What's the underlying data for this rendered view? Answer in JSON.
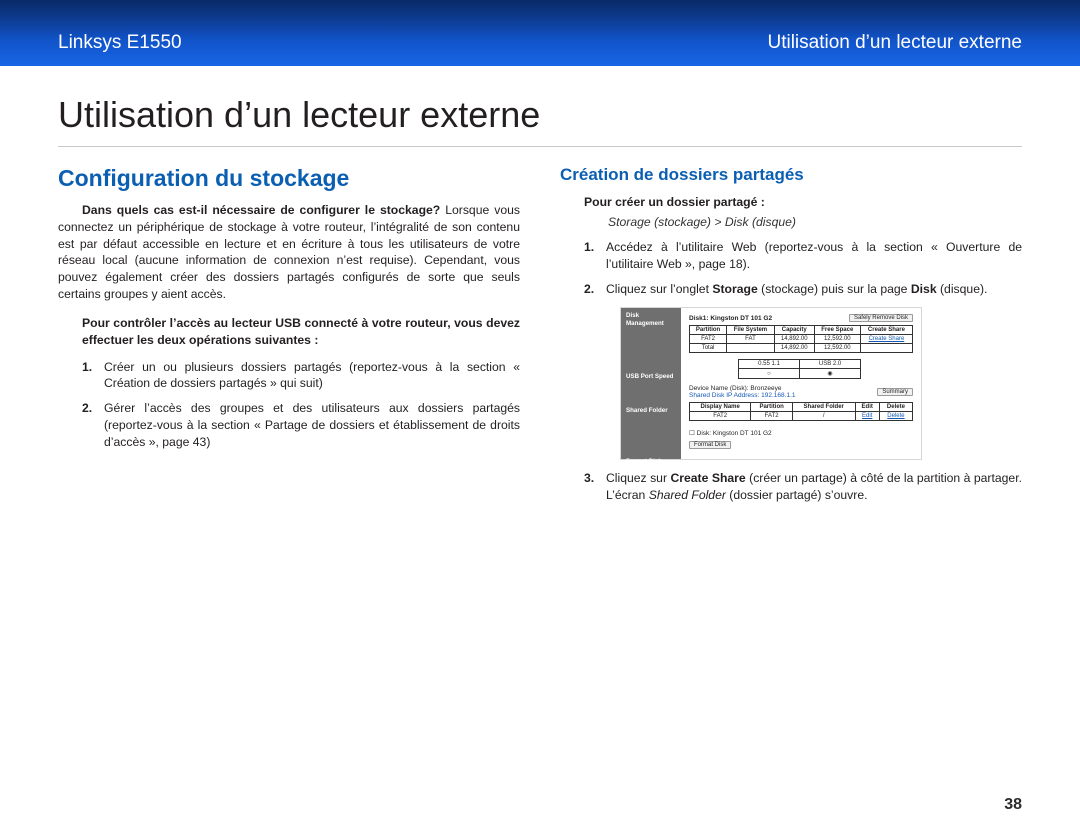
{
  "header": {
    "left": "Linksys E1550",
    "right": "Utilisation d’un lecteur externe"
  },
  "title": "Utilisation d’un lecteur externe",
  "page_number": "38",
  "left": {
    "h2": "Configuration du stockage",
    "para_lead": "Dans quels cas est-il nécessaire de configurer le stockage?",
    "para_rest": " Lorsque vous connectez un périphérique de stockage à votre routeur, l’intégralité de son contenu est par défaut accessible en lecture et en écriture à tous les utilisateurs de votre réseau local (aucune information de connexion n’est requise). Cependant, vous pouvez également créer des dossiers partagés configurés de sorte que seuls certains groupes y aient accès.",
    "bold_intro": "Pour contrôler l’accès au lecteur USB connecté à votre routeur, vous devez effectuer les deux opérations suivantes :",
    "steps": [
      "Créer un ou plusieurs dossiers partagés (reportez-vous à la section « Création de dossiers partagés » qui suit)",
      "Gérer l’accès des groupes et des utilisateurs aux dossiers partagés (reportez-vous à la section « Partage de dossiers et établissement de droits d’accès », page 43)"
    ]
  },
  "right": {
    "h3": "Création de dossiers partagés",
    "sub_bold": "Pour créer un dossier partagé :",
    "crumb": "Storage (stockage) > Disk (disque)",
    "step1_pre": "Accédez à l’utilitaire Web (reportez-vous à la section « Ouverture de l’utilitaire Web », page 18).",
    "step2_pre": "Cliquez sur l’onglet ",
    "step2_b1": "Storage",
    "step2_mid": " (stockage) puis sur la page ",
    "step2_b2": "Disk",
    "step2_end": " (disque).",
    "step3_pre": "Cliquez sur ",
    "step3_b": "Create Share",
    "step3_mid": " (créer un partage) à côté de la partition à partager. L’écran ",
    "step3_i": "Shared Folder",
    "step3_end": " (dossier partagé) s’ouvre."
  },
  "shot": {
    "side": {
      "disk": "Disk Management",
      "usb": "USB Port Speed",
      "shared": "Shared Folder",
      "format": "Format Disk"
    },
    "disk_title": "Disk1: Kingston DT 101 G2",
    "btn_refresh": "Safely Remove Disk",
    "t1": {
      "h": [
        "Partition",
        "File System",
        "Capacity",
        "Free Space",
        "Create Share"
      ],
      "r1": [
        "FAT2",
        "FAT",
        "14,892.00",
        "12,592.00",
        "Create Share"
      ],
      "r2": [
        "Total",
        "",
        "14,892.00",
        "12,592.00",
        ""
      ]
    },
    "usb": {
      "l": "0.55 1.1",
      "r": "USB 2.0"
    },
    "device": "Device Name (Disk): Bronzeeye",
    "ip_lab": "Shared Disk IP Address:",
    "ip": "192.168.1.1",
    "btn_summary": "Summary",
    "t2": {
      "h": [
        "Display Name",
        "Partition",
        "Shared Folder",
        "Edit",
        "Delete"
      ],
      "r": [
        "FAT2",
        "FAT2",
        "/",
        "Edit",
        "Delete"
      ]
    },
    "chk": "Disk: Kingston DT 101 G2",
    "btn_format": "Format Disk"
  }
}
